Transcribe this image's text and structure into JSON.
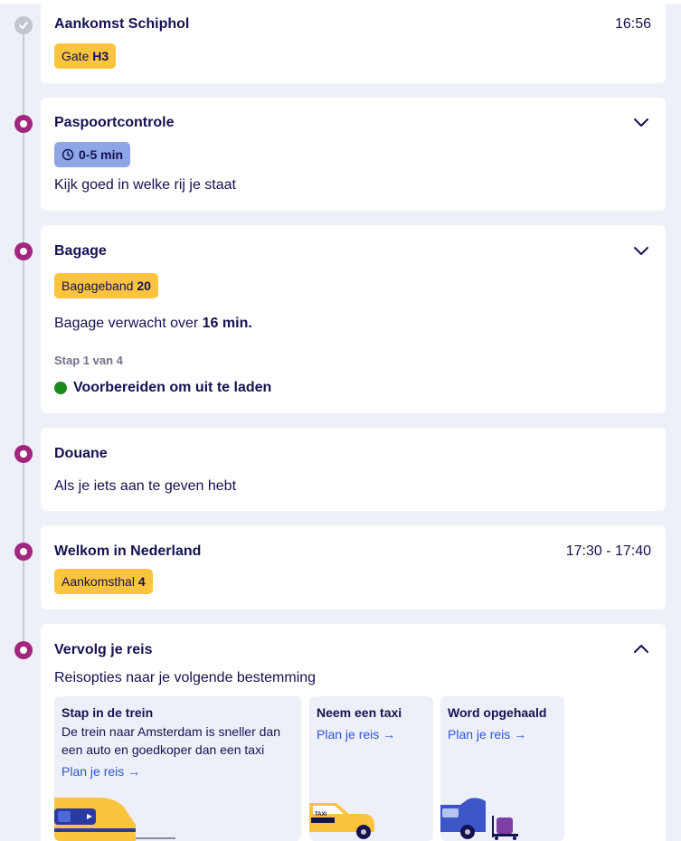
{
  "steps": [
    {
      "title": "Aankomst Schiphol",
      "time": "16:56",
      "badge_prefix": "Gate",
      "badge_value": "H3"
    },
    {
      "title": "Paspoortcontrole",
      "badge": "0-5 min",
      "text": "Kijk goed in welke rij je staat"
    },
    {
      "title": "Bagage",
      "badge_prefix": "Bagageband",
      "badge_value": "20",
      "text_prefix": "Bagage verwacht over",
      "text_value": "16 min.",
      "step_label": "Stap 1 van 4",
      "status": "Voorbereiden om uit te laden"
    },
    {
      "title": "Douane",
      "text": "Als je iets aan te geven hebt"
    },
    {
      "title": "Welkom in Nederland",
      "time": "17:30 - 17:40",
      "badge_prefix": "Aankomsthal",
      "badge_value": "4"
    },
    {
      "title": "Vervolg je reis",
      "text": "Reisopties naar je volgende bestemming"
    }
  ],
  "options": [
    {
      "title": "Stap in de trein",
      "desc": "De trein naar Amsterdam is sneller dan een auto en goedkoper dan een taxi",
      "link": "Plan je reis →"
    },
    {
      "title": "Neem een taxi",
      "link": "Plan je reis →"
    },
    {
      "title": "Word opgehaald",
      "link": "Plan je reis →"
    }
  ],
  "colors": {
    "accent": "#a3267e",
    "badge": "#fbc43f",
    "badge_blue": "#8fa6e6",
    "link": "#2e55d8",
    "text": "#141251"
  },
  "icons": [
    "check-icon",
    "clock-icon",
    "chevron-down-icon",
    "chevron-up-icon",
    "train-illustration",
    "taxi-illustration",
    "car-illustration"
  ]
}
